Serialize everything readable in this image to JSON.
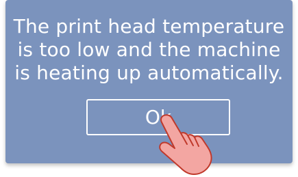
{
  "dialog": {
    "message_lines": [
      "The print head temperature",
      "is too low and the machine",
      "is heating up automatically."
    ],
    "ok_label": "Ok"
  },
  "colors": {
    "dialog_background": "#7b93bd",
    "text": "#ffffff",
    "hand_fill": "#f3a6a2",
    "hand_stroke": "#c0392b"
  },
  "icons": {
    "pointer": "tap-hand-icon"
  }
}
